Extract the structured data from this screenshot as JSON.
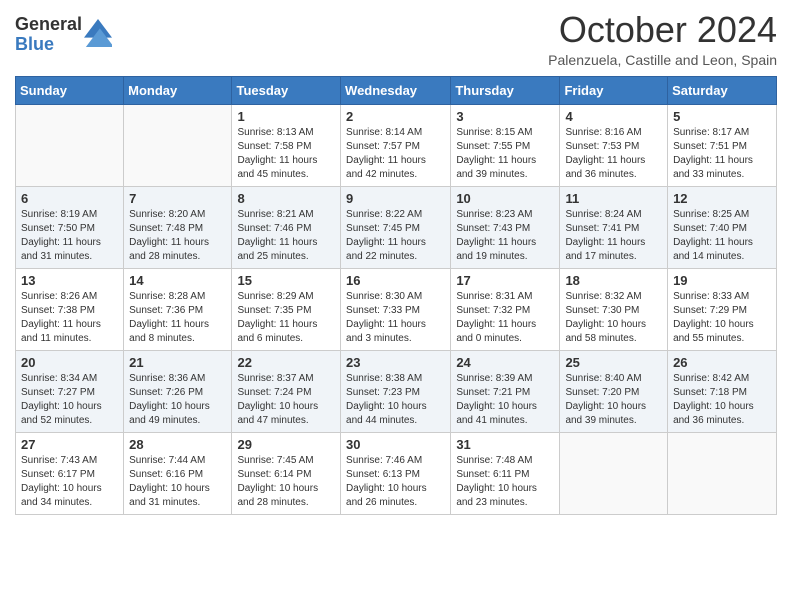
{
  "header": {
    "logo_general": "General",
    "logo_blue": "Blue",
    "month_title": "October 2024",
    "location": "Palenzuela, Castille and Leon, Spain"
  },
  "weekdays": [
    "Sunday",
    "Monday",
    "Tuesday",
    "Wednesday",
    "Thursday",
    "Friday",
    "Saturday"
  ],
  "weeks": [
    [
      {
        "day": "",
        "info": ""
      },
      {
        "day": "",
        "info": ""
      },
      {
        "day": "1",
        "info": "Sunrise: 8:13 AM\nSunset: 7:58 PM\nDaylight: 11 hours and 45 minutes."
      },
      {
        "day": "2",
        "info": "Sunrise: 8:14 AM\nSunset: 7:57 PM\nDaylight: 11 hours and 42 minutes."
      },
      {
        "day": "3",
        "info": "Sunrise: 8:15 AM\nSunset: 7:55 PM\nDaylight: 11 hours and 39 minutes."
      },
      {
        "day": "4",
        "info": "Sunrise: 8:16 AM\nSunset: 7:53 PM\nDaylight: 11 hours and 36 minutes."
      },
      {
        "day": "5",
        "info": "Sunrise: 8:17 AM\nSunset: 7:51 PM\nDaylight: 11 hours and 33 minutes."
      }
    ],
    [
      {
        "day": "6",
        "info": "Sunrise: 8:19 AM\nSunset: 7:50 PM\nDaylight: 11 hours and 31 minutes."
      },
      {
        "day": "7",
        "info": "Sunrise: 8:20 AM\nSunset: 7:48 PM\nDaylight: 11 hours and 28 minutes."
      },
      {
        "day": "8",
        "info": "Sunrise: 8:21 AM\nSunset: 7:46 PM\nDaylight: 11 hours and 25 minutes."
      },
      {
        "day": "9",
        "info": "Sunrise: 8:22 AM\nSunset: 7:45 PM\nDaylight: 11 hours and 22 minutes."
      },
      {
        "day": "10",
        "info": "Sunrise: 8:23 AM\nSunset: 7:43 PM\nDaylight: 11 hours and 19 minutes."
      },
      {
        "day": "11",
        "info": "Sunrise: 8:24 AM\nSunset: 7:41 PM\nDaylight: 11 hours and 17 minutes."
      },
      {
        "day": "12",
        "info": "Sunrise: 8:25 AM\nSunset: 7:40 PM\nDaylight: 11 hours and 14 minutes."
      }
    ],
    [
      {
        "day": "13",
        "info": "Sunrise: 8:26 AM\nSunset: 7:38 PM\nDaylight: 11 hours and 11 minutes."
      },
      {
        "day": "14",
        "info": "Sunrise: 8:28 AM\nSunset: 7:36 PM\nDaylight: 11 hours and 8 minutes."
      },
      {
        "day": "15",
        "info": "Sunrise: 8:29 AM\nSunset: 7:35 PM\nDaylight: 11 hours and 6 minutes."
      },
      {
        "day": "16",
        "info": "Sunrise: 8:30 AM\nSunset: 7:33 PM\nDaylight: 11 hours and 3 minutes."
      },
      {
        "day": "17",
        "info": "Sunrise: 8:31 AM\nSunset: 7:32 PM\nDaylight: 11 hours and 0 minutes."
      },
      {
        "day": "18",
        "info": "Sunrise: 8:32 AM\nSunset: 7:30 PM\nDaylight: 10 hours and 58 minutes."
      },
      {
        "day": "19",
        "info": "Sunrise: 8:33 AM\nSunset: 7:29 PM\nDaylight: 10 hours and 55 minutes."
      }
    ],
    [
      {
        "day": "20",
        "info": "Sunrise: 8:34 AM\nSunset: 7:27 PM\nDaylight: 10 hours and 52 minutes."
      },
      {
        "day": "21",
        "info": "Sunrise: 8:36 AM\nSunset: 7:26 PM\nDaylight: 10 hours and 49 minutes."
      },
      {
        "day": "22",
        "info": "Sunrise: 8:37 AM\nSunset: 7:24 PM\nDaylight: 10 hours and 47 minutes."
      },
      {
        "day": "23",
        "info": "Sunrise: 8:38 AM\nSunset: 7:23 PM\nDaylight: 10 hours and 44 minutes."
      },
      {
        "day": "24",
        "info": "Sunrise: 8:39 AM\nSunset: 7:21 PM\nDaylight: 10 hours and 41 minutes."
      },
      {
        "day": "25",
        "info": "Sunrise: 8:40 AM\nSunset: 7:20 PM\nDaylight: 10 hours and 39 minutes."
      },
      {
        "day": "26",
        "info": "Sunrise: 8:42 AM\nSunset: 7:18 PM\nDaylight: 10 hours and 36 minutes."
      }
    ],
    [
      {
        "day": "27",
        "info": "Sunrise: 7:43 AM\nSunset: 6:17 PM\nDaylight: 10 hours and 34 minutes."
      },
      {
        "day": "28",
        "info": "Sunrise: 7:44 AM\nSunset: 6:16 PM\nDaylight: 10 hours and 31 minutes."
      },
      {
        "day": "29",
        "info": "Sunrise: 7:45 AM\nSunset: 6:14 PM\nDaylight: 10 hours and 28 minutes."
      },
      {
        "day": "30",
        "info": "Sunrise: 7:46 AM\nSunset: 6:13 PM\nDaylight: 10 hours and 26 minutes."
      },
      {
        "day": "31",
        "info": "Sunrise: 7:48 AM\nSunset: 6:11 PM\nDaylight: 10 hours and 23 minutes."
      },
      {
        "day": "",
        "info": ""
      },
      {
        "day": "",
        "info": ""
      }
    ]
  ]
}
